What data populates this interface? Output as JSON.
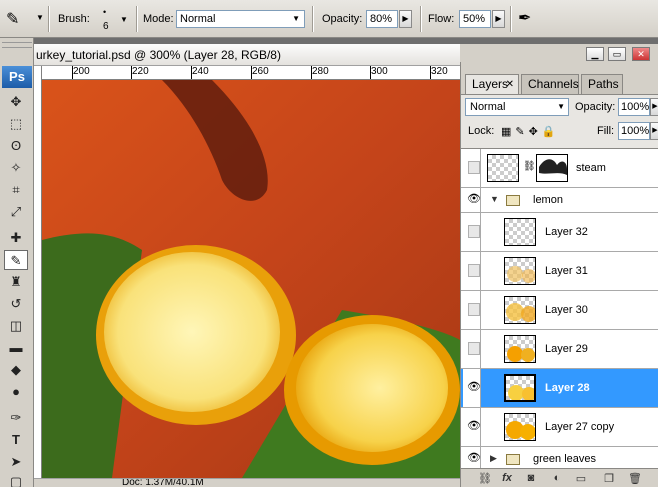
{
  "options_bar": {
    "brush_label": "Brush:",
    "brush_size": "6",
    "mode_label": "Mode:",
    "mode_value": "Normal",
    "opacity_label": "Opacity:",
    "opacity_value": "80%",
    "flow_label": "Flow:",
    "flow_value": "50%"
  },
  "toolbox": {
    "logo": "Ps"
  },
  "document": {
    "title": "urkey_tutorial.psd @ 300% (Layer 28, RGB/8)",
    "ruler_labels": [
      "200",
      "220",
      "240",
      "260",
      "280",
      "300",
      "320"
    ],
    "status": "Doc: 1.37M/40.1M"
  },
  "panel": {
    "tabs": [
      "Layers",
      "Channels",
      "Paths"
    ],
    "blend_mode": "Normal",
    "opacity_label": "Opacity:",
    "opacity_value": "100%",
    "lock_label": "Lock:",
    "fill_label": "Fill:",
    "fill_value": "100%",
    "layers": [
      {
        "name": "steam",
        "visible": false,
        "type": "layer-with-mask"
      },
      {
        "name": "lemon",
        "visible": true,
        "type": "group",
        "expanded": true
      },
      {
        "name": "Layer 32",
        "visible": false,
        "type": "layer"
      },
      {
        "name": "Layer 31",
        "visible": false,
        "type": "layer"
      },
      {
        "name": "Layer 30",
        "visible": false,
        "type": "layer"
      },
      {
        "name": "Layer 29",
        "visible": false,
        "type": "layer"
      },
      {
        "name": "Layer 28",
        "visible": true,
        "type": "layer",
        "selected": true
      },
      {
        "name": "Layer 27 copy",
        "visible": true,
        "type": "layer"
      },
      {
        "name": "green leaves",
        "visible": true,
        "type": "group",
        "expanded": false
      }
    ]
  },
  "colors": {
    "selection": "#3399ff",
    "panel_bg": "#d4d0c8"
  }
}
